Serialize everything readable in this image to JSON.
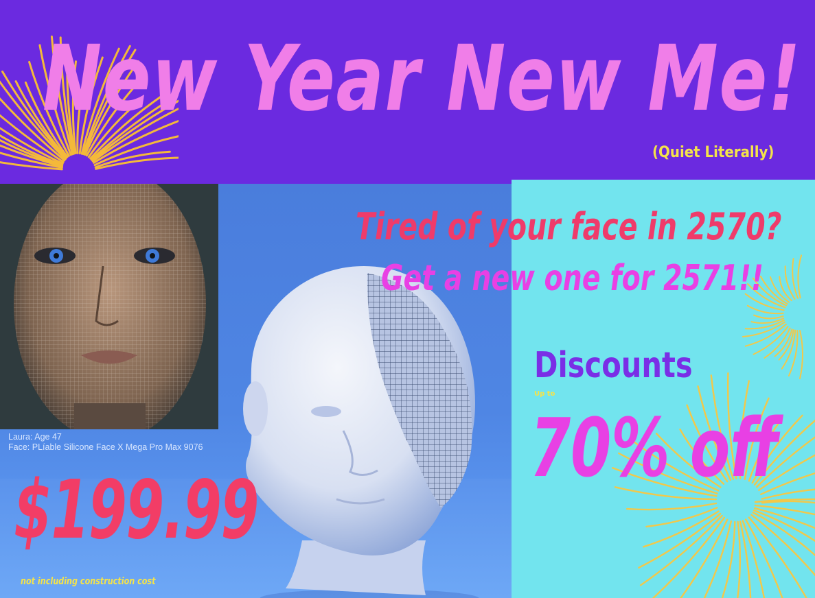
{
  "headline": "New Year New Me!",
  "sub_headline": "(Quiet Literally)",
  "tagline_1": "Tired of your face in 2570?",
  "tagline_2": "Get a new one for 2571!!",
  "portrait_caption": {
    "line1": "Laura: Age 47",
    "line2": "Face: PLíable Silicone Face X Mega Pro Max 9076"
  },
  "price": "$199.99",
  "price_note": "not including construction cost",
  "discounts": {
    "label": "Discounts",
    "up_to": "Up to",
    "amount": "70% off"
  },
  "colors": {
    "banner": "#6b2ae0",
    "headline": "#f07ee8",
    "accent_yellow": "#f4e34a",
    "price_red": "#f23d66",
    "magenta": "#e840e4",
    "cyan_panel": "#72e4ee",
    "blue_panel": "#4f86e4"
  }
}
